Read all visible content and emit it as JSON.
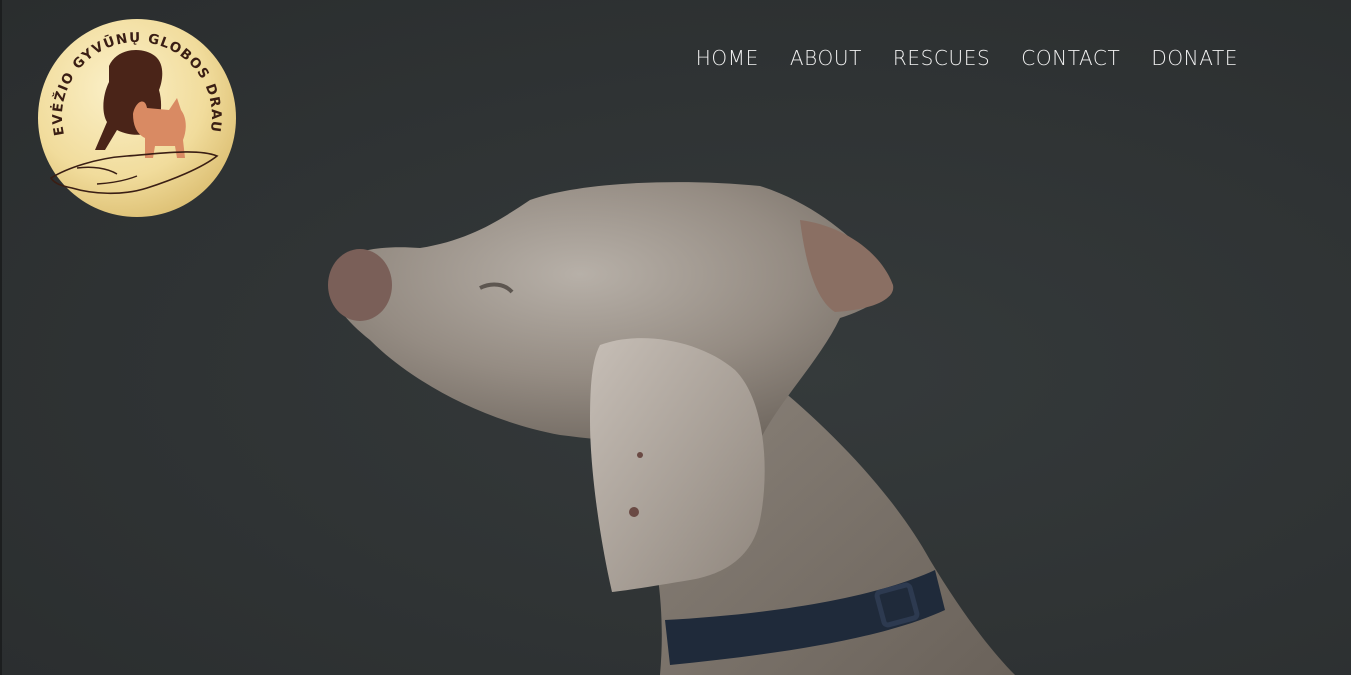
{
  "logo": {
    "ring_text": "PANEVĖŽIO GYVŪNŲ GLOBOS DRAUGIJA",
    "icon": "dog-cat-hand-emblem",
    "colors": {
      "gold_light": "#f7e6b0",
      "gold_dark": "#d8b96a",
      "dog": "#4a2418",
      "cat": "#d98a63",
      "text": "#3a1e14"
    }
  },
  "nav": {
    "items": [
      {
        "label": "HOME"
      },
      {
        "label": "ABOUT"
      },
      {
        "label": "RESCUES"
      },
      {
        "label": "CONTACT"
      },
      {
        "label": "DONATE"
      }
    ]
  },
  "hero": {
    "image": "weimaraner-dog-profile",
    "background": "#2f3233"
  }
}
